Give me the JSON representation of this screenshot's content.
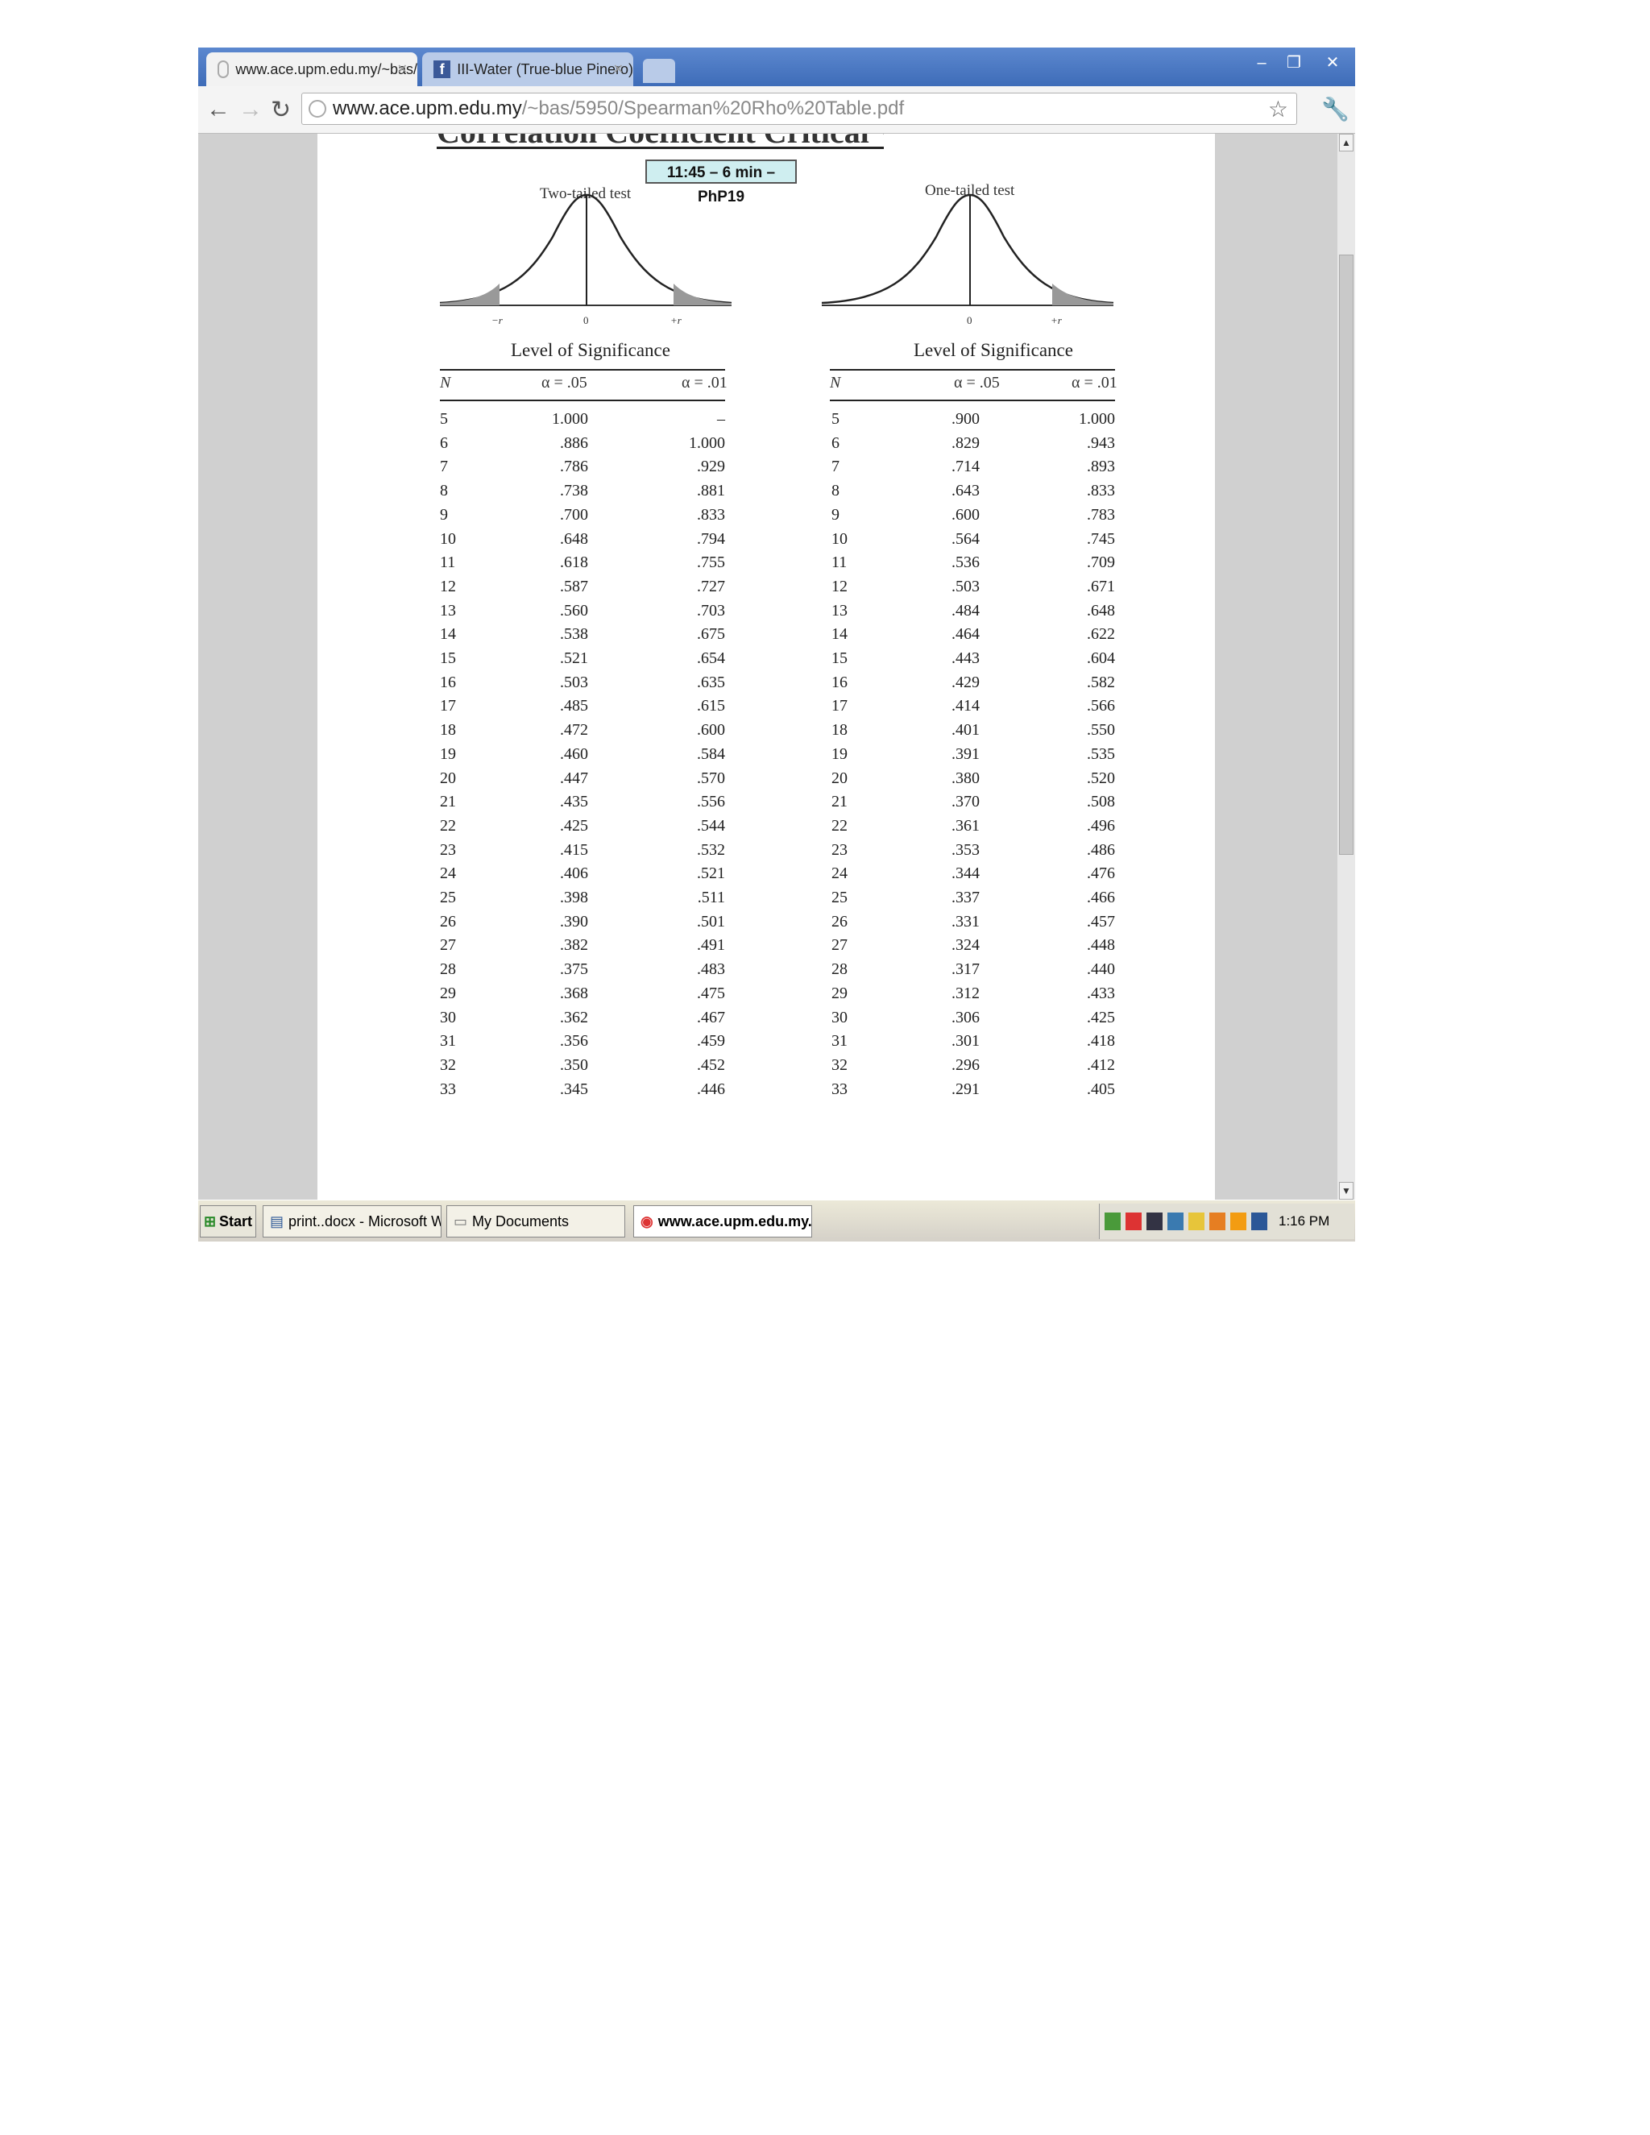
{
  "browser": {
    "tabs": [
      {
        "label": "www.ace.upm.edu.my/~bas/",
        "icon": "loading-page-icon"
      },
      {
        "label": "III-Water (True-blue Pinero)",
        "icon": "facebook-icon"
      }
    ],
    "url_host": "www.ace.upm.edu.my",
    "url_path": "/~bas/5950/Spearman%20Rho%20Table.pdf"
  },
  "document": {
    "sticky_note": "11:45 – 6 min – PhP19",
    "two_tailed_title": "Two-tailed test",
    "one_tailed_title": "One-tailed test",
    "axis_labels": {
      "neg": "−r",
      "zero": "0",
      "pos": "+r"
    },
    "level_label": "Level of Significance",
    "headers": {
      "n": "N",
      "a05": "α = .05",
      "a01": "α = .01"
    },
    "two_tailed_rows": [
      [
        "5",
        "1.000",
        "–"
      ],
      [
        "6",
        ".886",
        "1.000"
      ],
      [
        "7",
        ".786",
        ".929"
      ],
      [
        "8",
        ".738",
        ".881"
      ],
      [
        "9",
        ".700",
        ".833"
      ],
      [
        "10",
        ".648",
        ".794"
      ],
      [
        "11",
        ".618",
        ".755"
      ],
      [
        "12",
        ".587",
        ".727"
      ],
      [
        "13",
        ".560",
        ".703"
      ],
      [
        "14",
        ".538",
        ".675"
      ],
      [
        "15",
        ".521",
        ".654"
      ],
      [
        "16",
        ".503",
        ".635"
      ],
      [
        "17",
        ".485",
        ".615"
      ],
      [
        "18",
        ".472",
        ".600"
      ],
      [
        "19",
        ".460",
        ".584"
      ],
      [
        "20",
        ".447",
        ".570"
      ],
      [
        "21",
        ".435",
        ".556"
      ],
      [
        "22",
        ".425",
        ".544"
      ],
      [
        "23",
        ".415",
        ".532"
      ],
      [
        "24",
        ".406",
        ".521"
      ],
      [
        "25",
        ".398",
        ".511"
      ],
      [
        "26",
        ".390",
        ".501"
      ],
      [
        "27",
        ".382",
        ".491"
      ],
      [
        "28",
        ".375",
        ".483"
      ],
      [
        "29",
        ".368",
        ".475"
      ],
      [
        "30",
        ".362",
        ".467"
      ],
      [
        "31",
        ".356",
        ".459"
      ],
      [
        "32",
        ".350",
        ".452"
      ],
      [
        "33",
        ".345",
        ".446"
      ]
    ],
    "one_tailed_rows": [
      [
        "5",
        ".900",
        "1.000"
      ],
      [
        "6",
        ".829",
        ".943"
      ],
      [
        "7",
        ".714",
        ".893"
      ],
      [
        "8",
        ".643",
        ".833"
      ],
      [
        "9",
        ".600",
        ".783"
      ],
      [
        "10",
        ".564",
        ".745"
      ],
      [
        "11",
        ".536",
        ".709"
      ],
      [
        "12",
        ".503",
        ".671"
      ],
      [
        "13",
        ".484",
        ".648"
      ],
      [
        "14",
        ".464",
        ".622"
      ],
      [
        "15",
        ".443",
        ".604"
      ],
      [
        "16",
        ".429",
        ".582"
      ],
      [
        "17",
        ".414",
        ".566"
      ],
      [
        "18",
        ".401",
        ".550"
      ],
      [
        "19",
        ".391",
        ".535"
      ],
      [
        "20",
        ".380",
        ".520"
      ],
      [
        "21",
        ".370",
        ".508"
      ],
      [
        "22",
        ".361",
        ".496"
      ],
      [
        "23",
        ".353",
        ".486"
      ],
      [
        "24",
        ".344",
        ".476"
      ],
      [
        "25",
        ".337",
        ".466"
      ],
      [
        "26",
        ".331",
        ".457"
      ],
      [
        "27",
        ".324",
        ".448"
      ],
      [
        "28",
        ".317",
        ".440"
      ],
      [
        "29",
        ".312",
        ".433"
      ],
      [
        "30",
        ".306",
        ".425"
      ],
      [
        "31",
        ".301",
        ".418"
      ],
      [
        "32",
        ".296",
        ".412"
      ],
      [
        "33",
        ".291",
        ".405"
      ]
    ]
  },
  "taskbar": {
    "start": "Start",
    "tasks": [
      {
        "label": "print..docx - Microsoft W..."
      },
      {
        "label": "My Documents"
      },
      {
        "label": "www.ace.upm.edu.my..."
      }
    ],
    "clock": "1:16 PM"
  },
  "colors": {
    "titlebar": "#3e6cb8",
    "sticky": "#cfeef0",
    "taskbar": "#ece9d8"
  }
}
